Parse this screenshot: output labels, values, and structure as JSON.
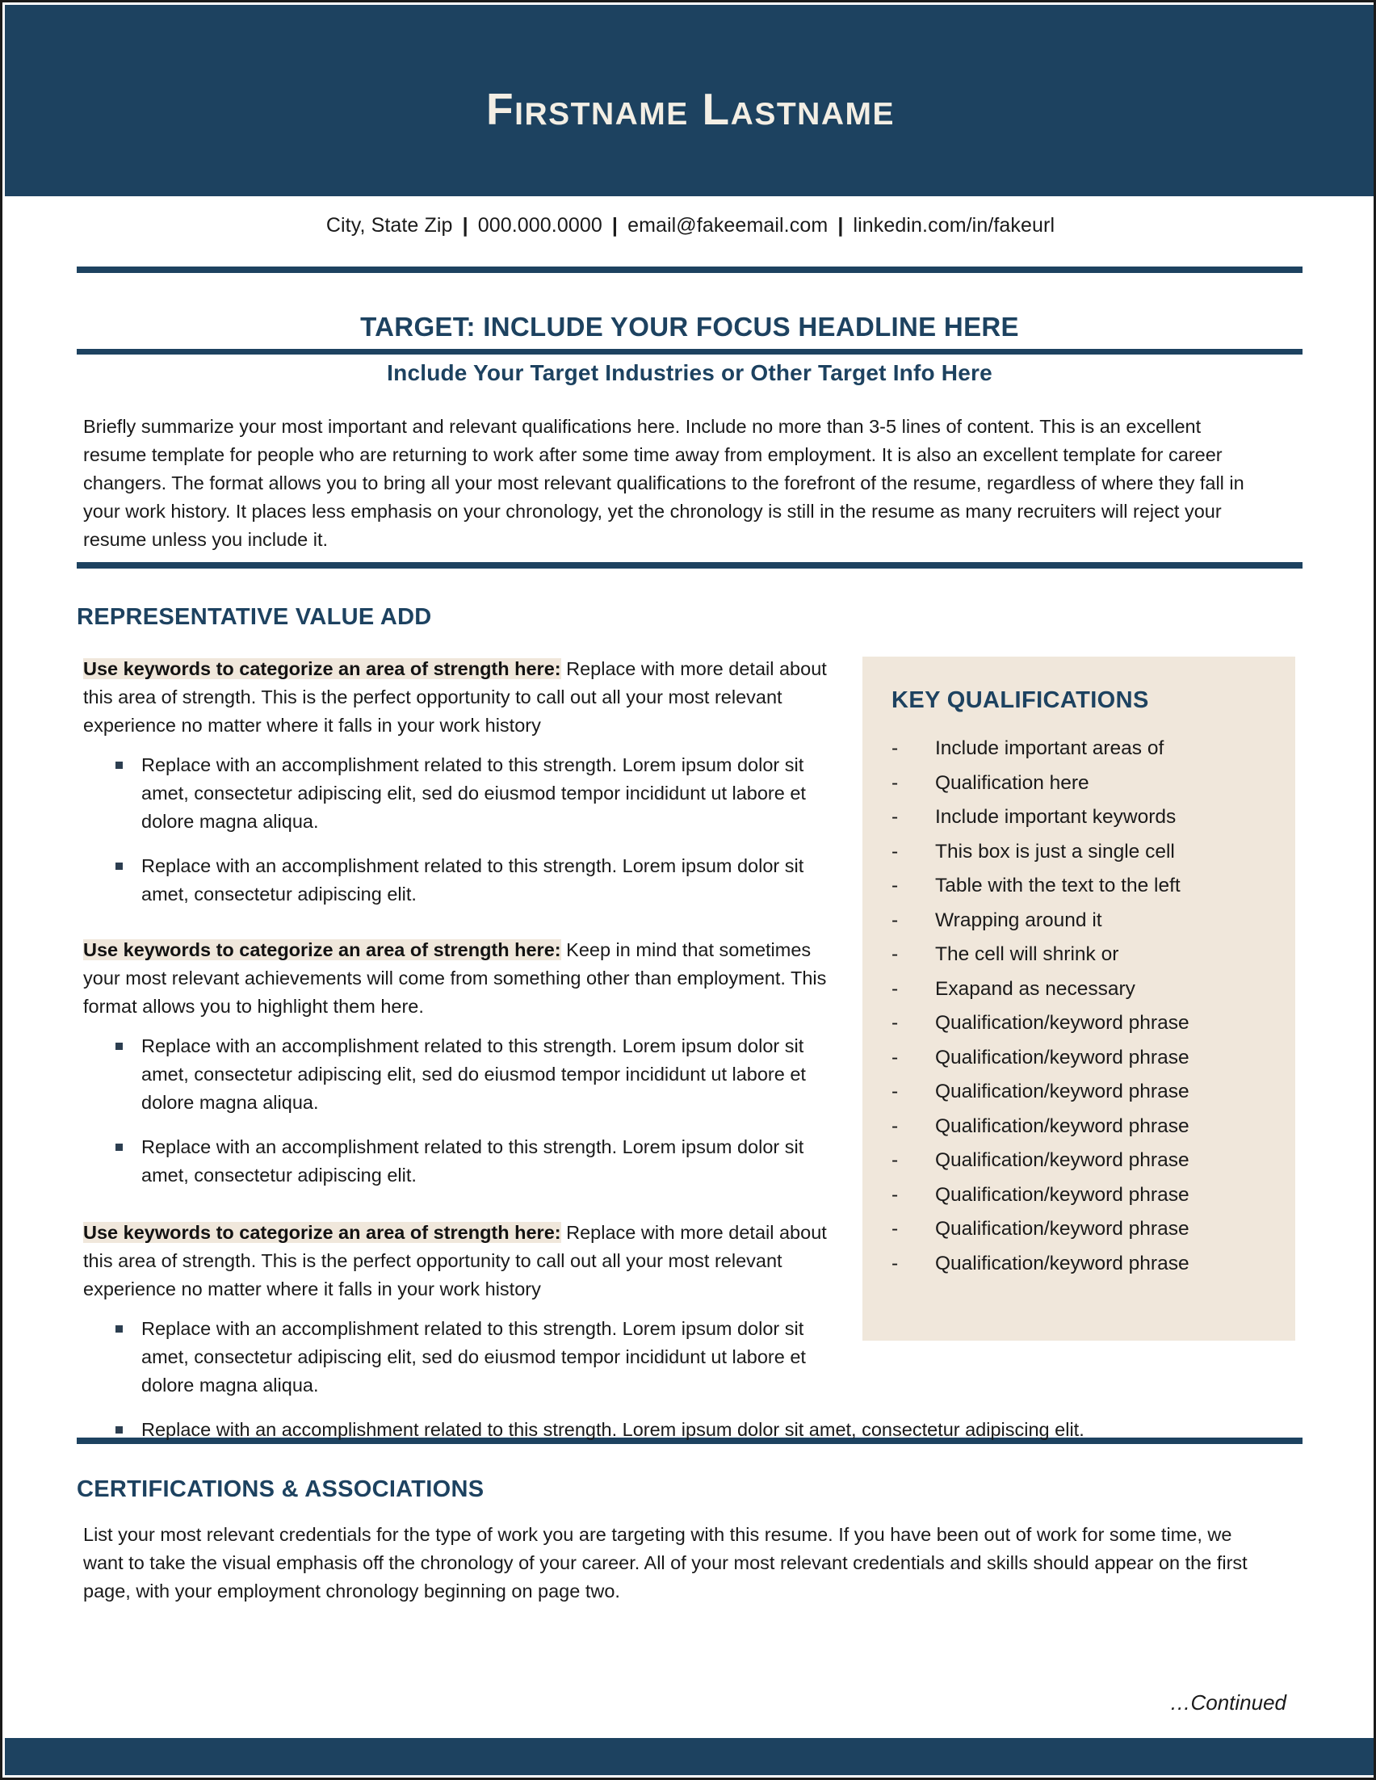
{
  "header": {
    "name": "Firstname Lastname",
    "band_color": "#1d4260",
    "name_color": "#f3eee4"
  },
  "contact": {
    "location": "City, State Zip",
    "phone": "000.000.0000",
    "email": "email@fakeemail.com",
    "linkedin": "linkedin.com/in/fakeurl",
    "separator": "|"
  },
  "target": {
    "headline": "TARGET: INCLUDE YOUR FOCUS HEADLINE HERE",
    "subhead": "Include Your Target Industries or Other Target Info Here"
  },
  "summary": {
    "text": "Briefly summarize your most important and relevant qualifications here. Include no more than 3-5 lines of content. This is an excellent resume template for people who are returning to work after some time away from employment. It is also an excellent template for career changers. The format allows you to bring all your most relevant qualifications to the forefront of the resume, regardless of where they fall in your work history. It places less emphasis on your chronology, yet the chronology is still in the resume as many recruiters will reject your resume unless you include it."
  },
  "sections": {
    "representative_value_add": "REPRESENTATIVE VALUE ADD",
    "certifications": "CERTIFICATIONS & ASSOCIATIONS"
  },
  "strengths": [
    {
      "lead": "Use keywords to categorize an area of strength here:",
      "body": " Replace with more detail about this area of strength. This is the perfect opportunity to call out all your most relevant experience no matter where it falls in your work history",
      "bullets": [
        "Replace with an accomplishment related to this strength. Lorem ipsum dolor sit amet, consectetur adipiscing elit, sed do eiusmod tempor incididunt ut labore et dolore magna aliqua.",
        "Replace with an accomplishment related to this strength. Lorem ipsum dolor sit amet, consectetur adipiscing elit."
      ]
    },
    {
      "lead": "Use keywords to categorize an area of strength here:",
      "body": " Keep in mind that sometimes your most relevant achievements will come from something other than employment. This format allows you to highlight them here.",
      "bullets": [
        "Replace with an accomplishment related to this strength. Lorem ipsum dolor sit amet, consectetur adipiscing elit, sed do eiusmod tempor incididunt ut labore et dolore magna aliqua.",
        "Replace with an accomplishment related to this strength. Lorem ipsum dolor sit amet, consectetur adipiscing elit."
      ]
    },
    {
      "lead": "Use keywords to categorize an area of strength here:",
      "body": " Replace with more detail about this area of strength. This is the perfect opportunity to call out all your most relevant experience no matter where it falls in your work history",
      "bullets": [
        "Replace with an accomplishment related to this strength. Lorem ipsum dolor sit amet, consectetur adipiscing elit, sed do eiusmod tempor incididunt ut labore et dolore magna aliqua.",
        "Replace with an accomplishment related to this strength. Lorem ipsum dolor sit amet, consectetur adipiscing elit."
      ]
    }
  ],
  "key_qualifications": {
    "title": "KEY QUALIFICATIONS",
    "bullet_marker": "-",
    "background_color": "#f0e7db",
    "items": [
      "Include important areas of",
      "Qualification here",
      "Include important keywords",
      "This box is just a single cell",
      "Table with the text to the left",
      "Wrapping around it",
      "The cell will shrink or",
      "Exapand as necessary",
      "Qualification/keyword phrase",
      "Qualification/keyword phrase",
      "Qualification/keyword phrase",
      "Qualification/keyword phrase",
      "Qualification/keyword phrase",
      "Qualification/keyword phrase",
      "Qualification/keyword phrase",
      "Qualification/keyword phrase"
    ]
  },
  "certifications": {
    "body": "List your most relevant credentials for the type of work you are targeting with this resume. If you have been out of work for some time, we want to take the visual emphasis off the chronology of your career. All of your most relevant credentials and skills should appear on the first page, with your employment chronology beginning on page two."
  },
  "footer": {
    "continued": "…Continued"
  }
}
